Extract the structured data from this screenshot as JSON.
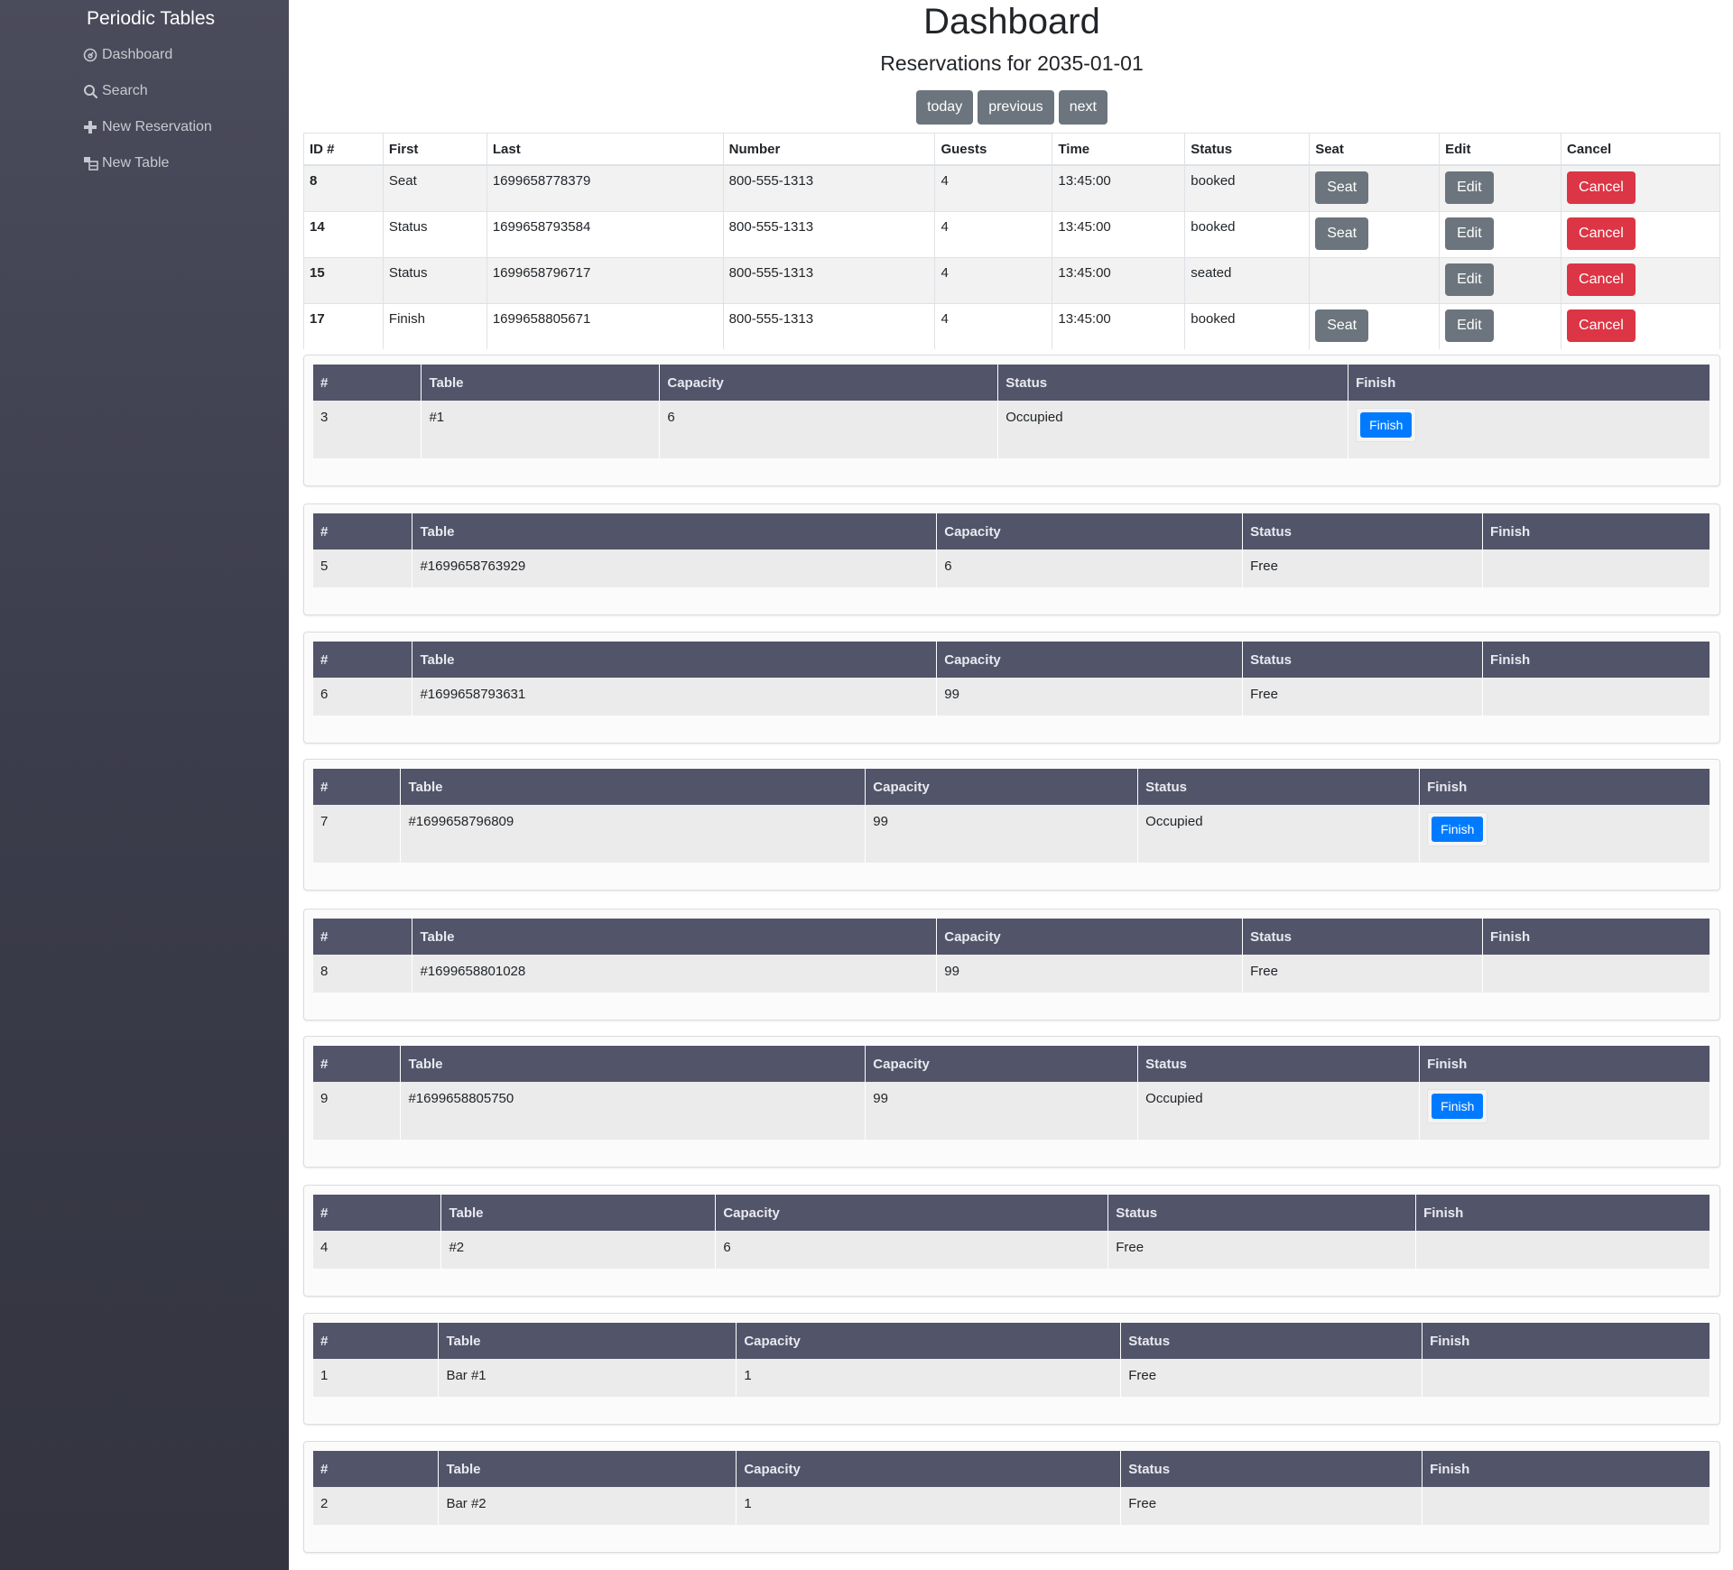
{
  "sidebar": {
    "brand": "Periodic Tables",
    "items": [
      {
        "label": "Dashboard",
        "icon": "dashboard-icon"
      },
      {
        "label": "Search",
        "icon": "search-icon"
      },
      {
        "label": "New Reservation",
        "icon": "plus-icon"
      },
      {
        "label": "New Table",
        "icon": "table-icon"
      }
    ]
  },
  "header": {
    "title": "Dashboard",
    "subtitle": "Reservations for 2035-01-01",
    "buttons": {
      "today": "today",
      "previous": "previous",
      "next": "next"
    }
  },
  "reservations": {
    "columns": [
      "ID #",
      "First",
      "Last",
      "Number",
      "Guests",
      "Time",
      "Status",
      "Seat",
      "Edit",
      "Cancel"
    ],
    "rows": [
      {
        "id": "8",
        "first": "Seat",
        "last": "1699658778379",
        "number": "800-555-1313",
        "guests": "4",
        "time": "13:45:00",
        "status": "booked",
        "seat": "Seat",
        "edit": "Edit",
        "cancel": "Cancel"
      },
      {
        "id": "14",
        "first": "Status",
        "last": "1699658793584",
        "number": "800-555-1313",
        "guests": "4",
        "time": "13:45:00",
        "status": "booked",
        "seat": "Seat",
        "edit": "Edit",
        "cancel": "Cancel"
      },
      {
        "id": "15",
        "first": "Status",
        "last": "1699658796717",
        "number": "800-555-1313",
        "guests": "4",
        "time": "13:45:00",
        "status": "seated",
        "seat": "",
        "edit": "Edit",
        "cancel": "Cancel"
      },
      {
        "id": "17",
        "first": "Finish",
        "last": "1699658805671",
        "number": "800-555-1313",
        "guests": "4",
        "time": "13:45:00",
        "status": "booked",
        "seat": "Seat",
        "edit": "Edit",
        "cancel": "Cancel"
      }
    ]
  },
  "tables": {
    "columns": [
      "#",
      "Table",
      "Capacity",
      "Status",
      "Finish"
    ],
    "finish_label": "Finish",
    "items": [
      {
        "num": "3",
        "name": "#1",
        "capacity": "6",
        "status": "Occupied"
      },
      {
        "num": "5",
        "name": "#1699658763929",
        "capacity": "6",
        "status": "Free"
      },
      {
        "num": "6",
        "name": "#1699658793631",
        "capacity": "99",
        "status": "Free"
      },
      {
        "num": "7",
        "name": "#1699658796809",
        "capacity": "99",
        "status": "Occupied"
      },
      {
        "num": "8",
        "name": "#1699658801028",
        "capacity": "99",
        "status": "Free"
      },
      {
        "num": "9",
        "name": "#1699658805750",
        "capacity": "99",
        "status": "Occupied"
      },
      {
        "num": "4",
        "name": "#2",
        "capacity": "6",
        "status": "Free"
      },
      {
        "num": "1",
        "name": "Bar #1",
        "capacity": "1",
        "status": "Free"
      },
      {
        "num": "2",
        "name": "Bar #2",
        "capacity": "1",
        "status": "Free"
      }
    ]
  },
  "colors": {
    "sidebar": "#3b3c4b",
    "table_header": "#52546a",
    "secondary": "#6c757d",
    "danger": "#dc3545",
    "primary": "#007bff"
  }
}
